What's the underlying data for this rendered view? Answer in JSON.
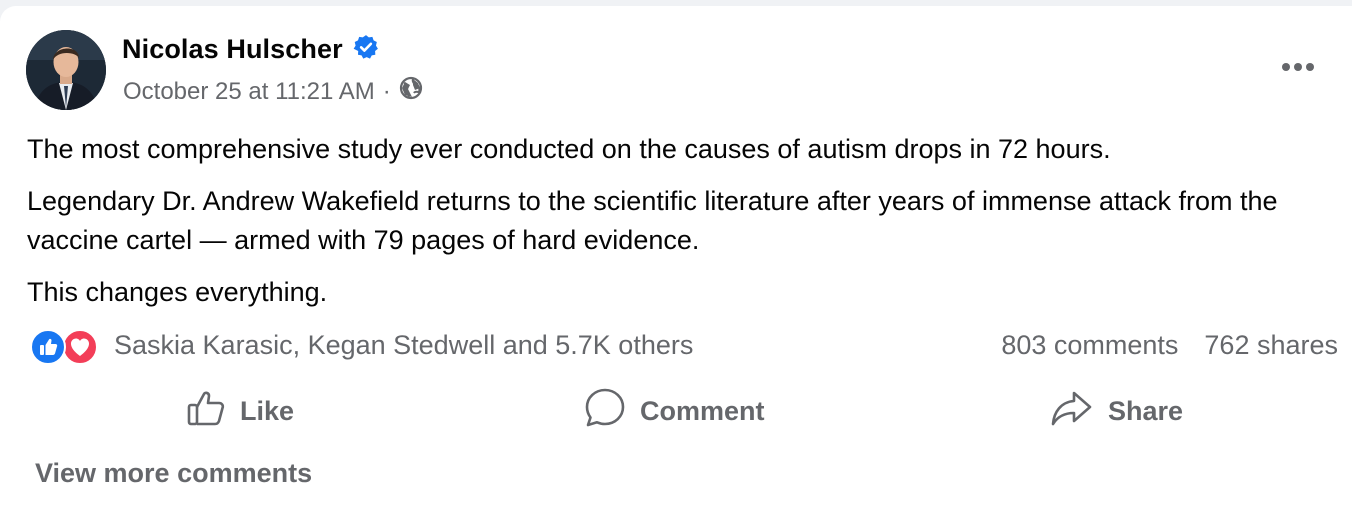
{
  "post": {
    "author": "Nicolas Hulscher",
    "timestamp": "October 25 at 11:21 AM",
    "separator": "·",
    "paragraphs": [
      "The most comprehensive study ever conducted on the causes of autism drops in 72 hours.",
      "Legendary Dr. Andrew Wakefield returns to the scientific literature after years of immense attack from the vaccine cartel — armed with 79 pages of hard evidence.",
      "This changes everything."
    ]
  },
  "reactions": {
    "icons": [
      "like-icon",
      "love-icon"
    ],
    "summary": "Saskia Karasic, Kegan Stedwell and 5.7K others",
    "comments": "803 comments",
    "shares": "762 shares"
  },
  "actions": {
    "like": "Like",
    "comment": "Comment",
    "share": "Share"
  },
  "footer": {
    "view_more": "View more comments"
  },
  "colors": {
    "verified": "#1877f2",
    "like": "#1877f2",
    "love": "#f33e58",
    "secondary_text": "#65676b"
  }
}
